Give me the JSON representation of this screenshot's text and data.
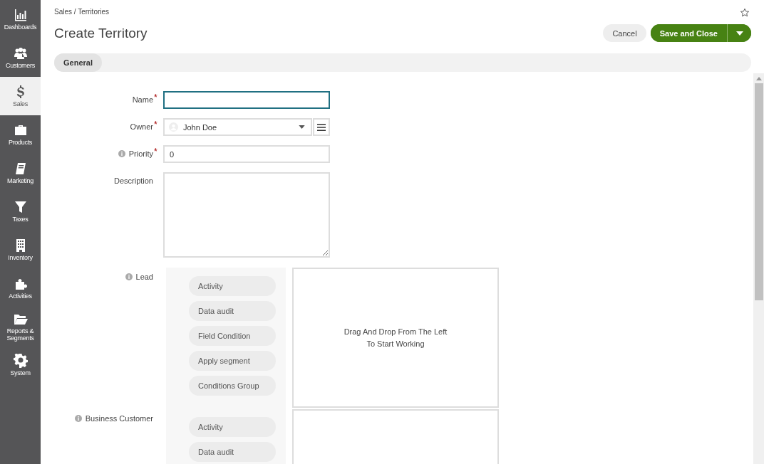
{
  "sidebar": {
    "items": [
      {
        "label": "Dashboards",
        "selected": false
      },
      {
        "label": "Customers",
        "selected": false
      },
      {
        "label": "Sales",
        "selected": true
      },
      {
        "label": "Products",
        "selected": false
      },
      {
        "label": "Marketing",
        "selected": false
      },
      {
        "label": "Taxes",
        "selected": false
      },
      {
        "label": "Inventory",
        "selected": false
      },
      {
        "label": "Activities",
        "selected": false
      },
      {
        "label": "Reports & Segments",
        "selected": false
      },
      {
        "label": "System",
        "selected": false
      }
    ]
  },
  "breadcrumb": "Sales / Territories",
  "title": "Create Territory",
  "buttons": {
    "cancel": "Cancel",
    "save": "Save and Close"
  },
  "tabs": [
    {
      "label": "General",
      "selected": true
    }
  ],
  "fields": [
    {
      "kind": "text",
      "label": "Name",
      "required": true,
      "info": false,
      "focused": true
    },
    {
      "kind": "select",
      "label": "Owner",
      "required": true,
      "info": false,
      "value": "John Doe",
      "focused": false
    },
    {
      "kind": "text",
      "label": "Priority",
      "required": true,
      "info": true,
      "value": "0",
      "focused": false
    },
    {
      "kind": "textarea",
      "label": "Description",
      "required": false,
      "info": false,
      "focused": false
    }
  ],
  "required_mark": "*",
  "conditions": [
    {
      "label": "Lead",
      "palette": [
        "Activity",
        "Data audit",
        "Field Condition",
        "Apply segment",
        "Conditions Group"
      ],
      "drop_text": "Drag And Drop From The Left\nTo Start Working"
    },
    {
      "label": "Business Customer",
      "palette": [
        "Activity",
        "Data audit"
      ]
    }
  ]
}
